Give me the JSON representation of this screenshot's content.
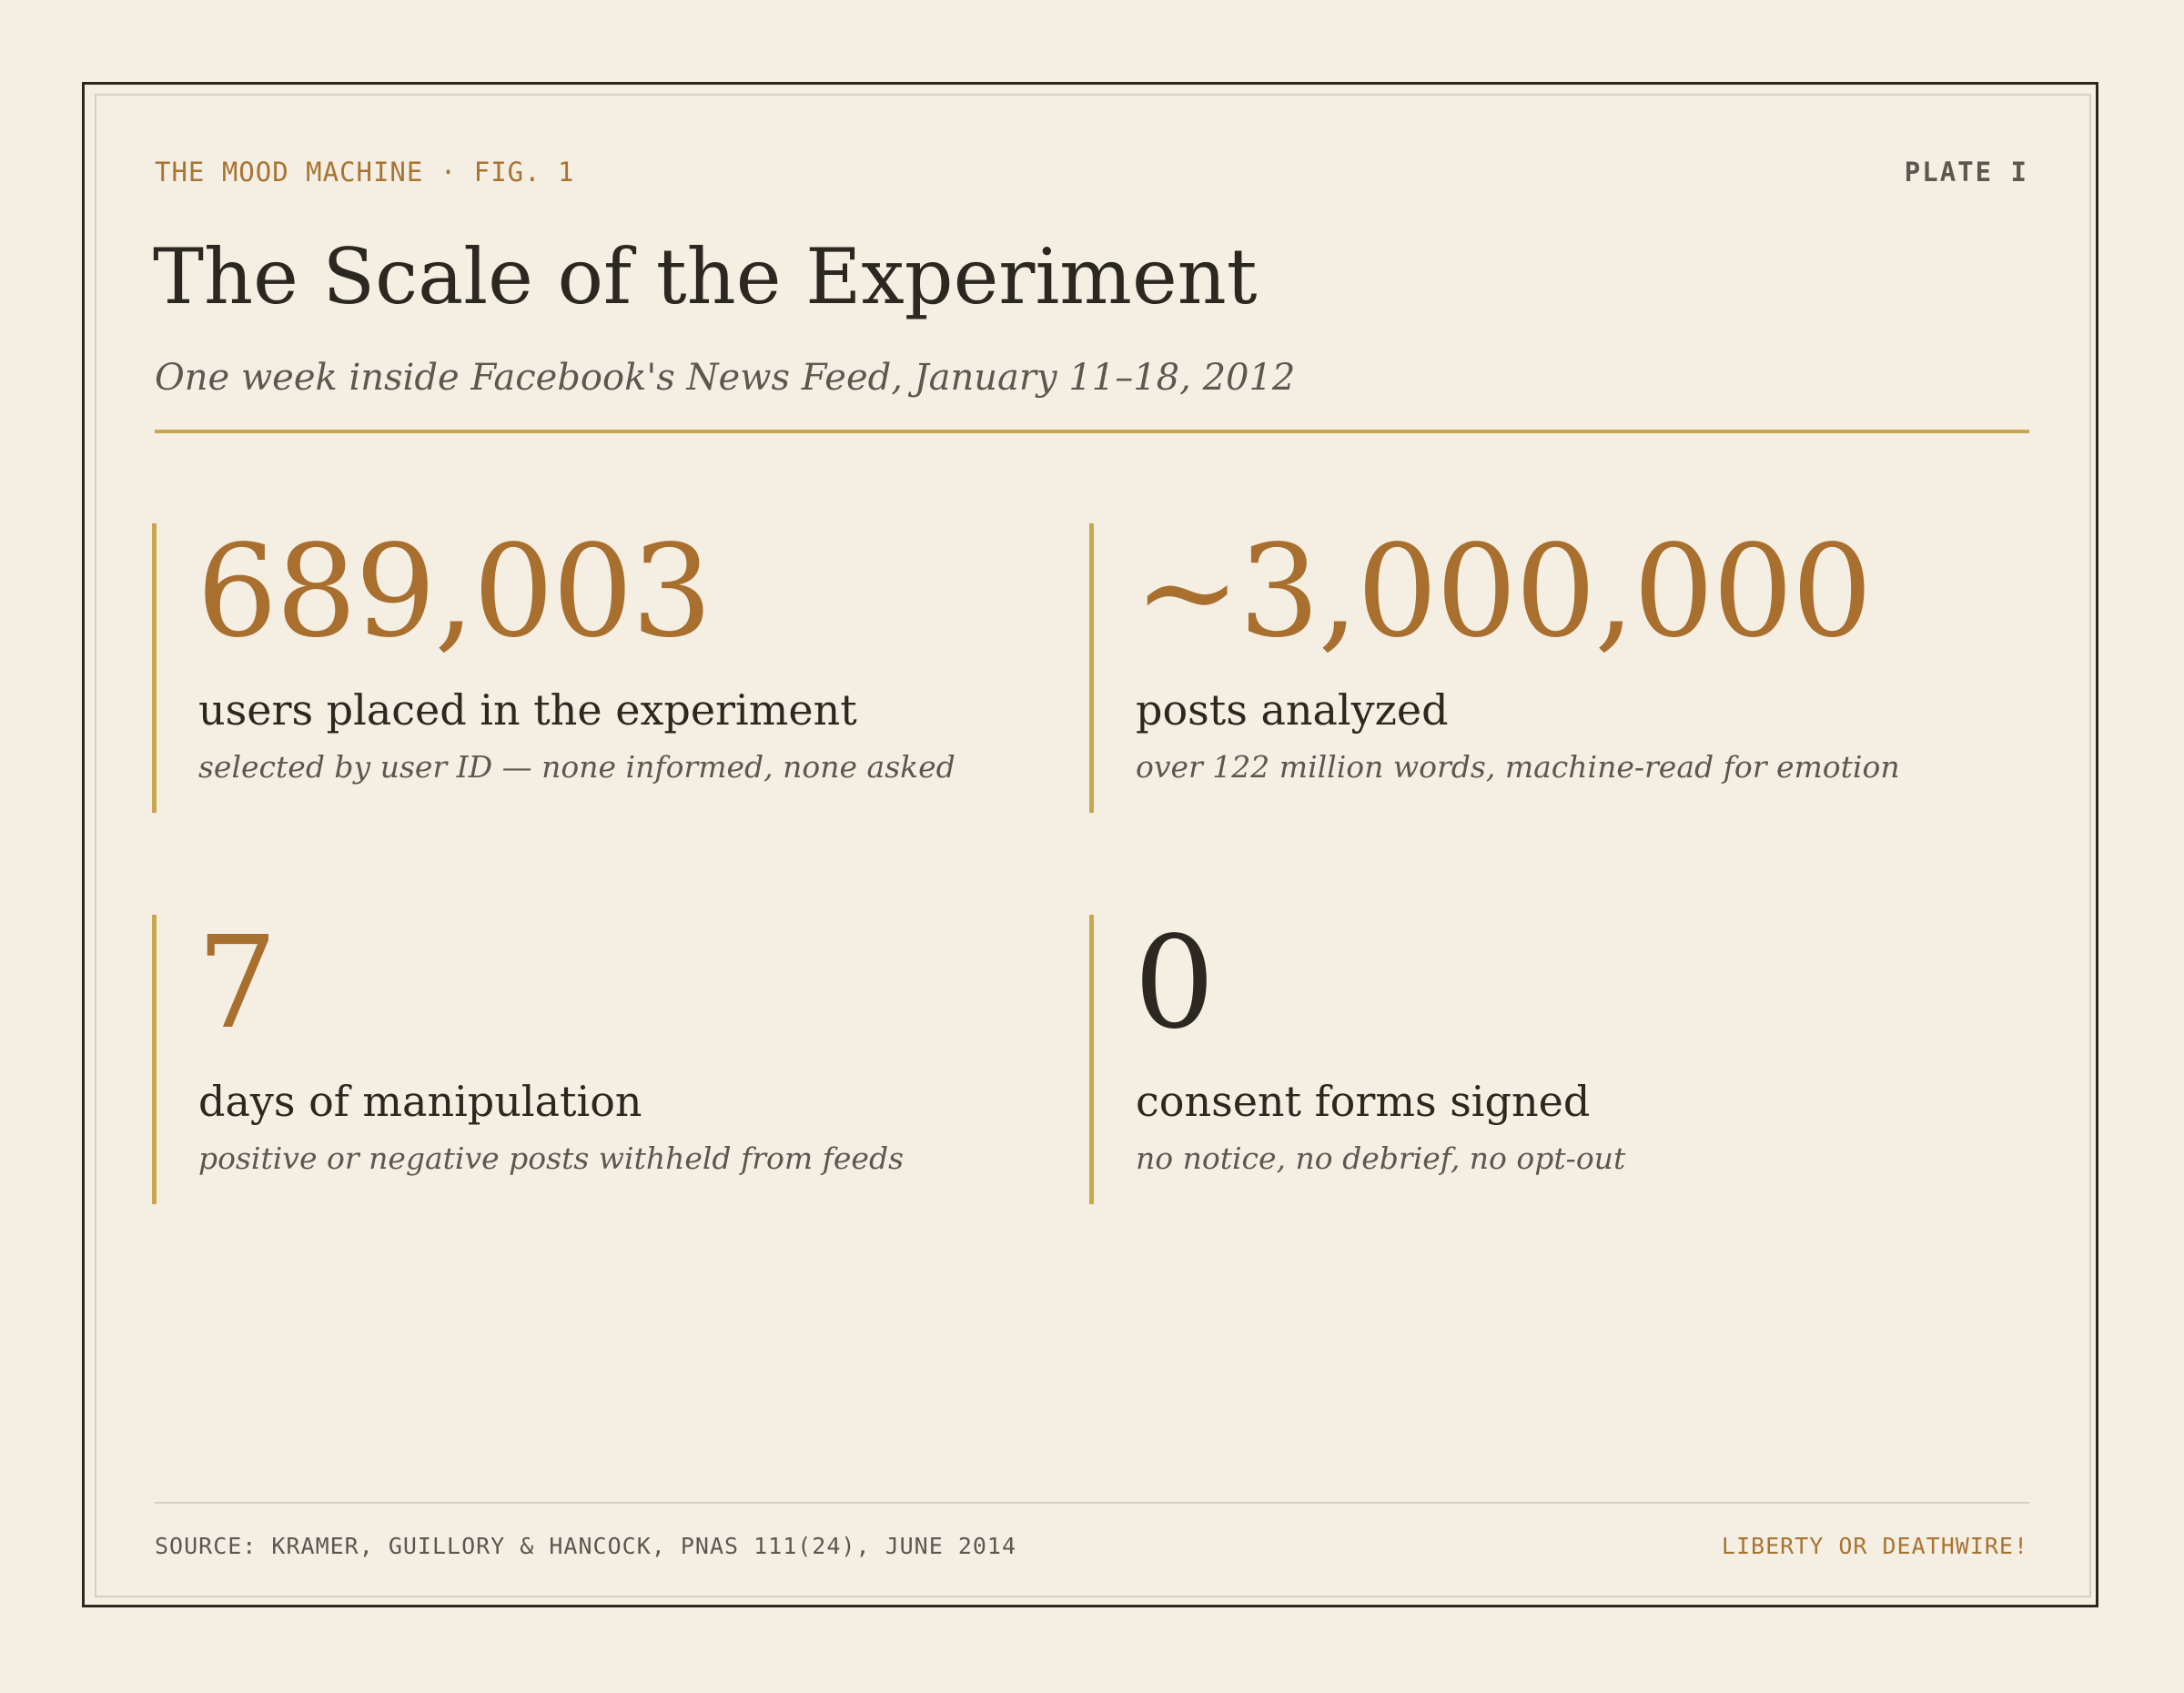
{
  "header": {
    "kicker": "THE MOOD MACHINE · FIG. 1",
    "plate": "PLATE I",
    "title": "The Scale of the Experiment",
    "subtitle": "One week inside Facebook's News Feed, January 11–18, 2012"
  },
  "stats": [
    {
      "value": "689,003",
      "label": "users placed in the experiment",
      "note": "selected by user ID — none informed, none asked",
      "color": "#a86f2e"
    },
    {
      "value": "~3,000,000",
      "label": "posts analyzed",
      "note": "over 122 million words, machine-read for emotion",
      "color": "#a86f2e"
    },
    {
      "value": "7",
      "label": "days of manipulation",
      "note": "positive or negative posts withheld from feeds",
      "color": "#a86f2e"
    },
    {
      "value": "0",
      "label": "consent forms signed",
      "note": "no notice, no debrief, no opt-out",
      "color": "#2a2820"
    }
  ],
  "footer": {
    "source": "SOURCE: KRAMER, GUILLORY & HANCOCK, PNAS 111(24), JUNE 2014",
    "brand": "LIBERTY OR DEATHWIRE!"
  },
  "colors": {
    "background": "#f5efe3",
    "accent": "#c9a64e",
    "number": "#a86f2e",
    "ink": "#2a2820",
    "muted": "#5c5850"
  }
}
